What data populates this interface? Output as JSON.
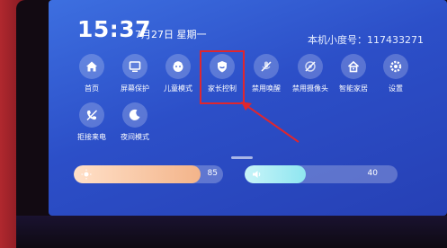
{
  "status": {
    "time": "15:37",
    "date": "7月27日 星期一",
    "device_id": "本机小度号：117433271"
  },
  "tiles": [
    {
      "label": "首页",
      "icon": "home-icon"
    },
    {
      "label": "屏幕保护",
      "icon": "screen-saver-icon"
    },
    {
      "label": "儿童模式",
      "icon": "child-mode-icon"
    },
    {
      "label": "家长控制",
      "icon": "parental-control-icon"
    },
    {
      "label": "禁用唤醒",
      "icon": "mute-mic-icon"
    },
    {
      "label": "禁用摄像头",
      "icon": "camera-off-icon"
    },
    {
      "label": "智能家居",
      "icon": "smart-home-icon"
    },
    {
      "label": "设置",
      "icon": "settings-icon"
    },
    {
      "label": "拒接来电",
      "icon": "reject-call-icon"
    },
    {
      "label": "夜间模式",
      "icon": "night-mode-icon"
    }
  ],
  "brightness": {
    "value": "85",
    "level": 0.85,
    "fill_color": "#f3b48a"
  },
  "volume": {
    "value": "40",
    "level": 0.4,
    "fill_color": "#8fe6f0"
  },
  "annotation": {
    "color": "#e0262e"
  }
}
